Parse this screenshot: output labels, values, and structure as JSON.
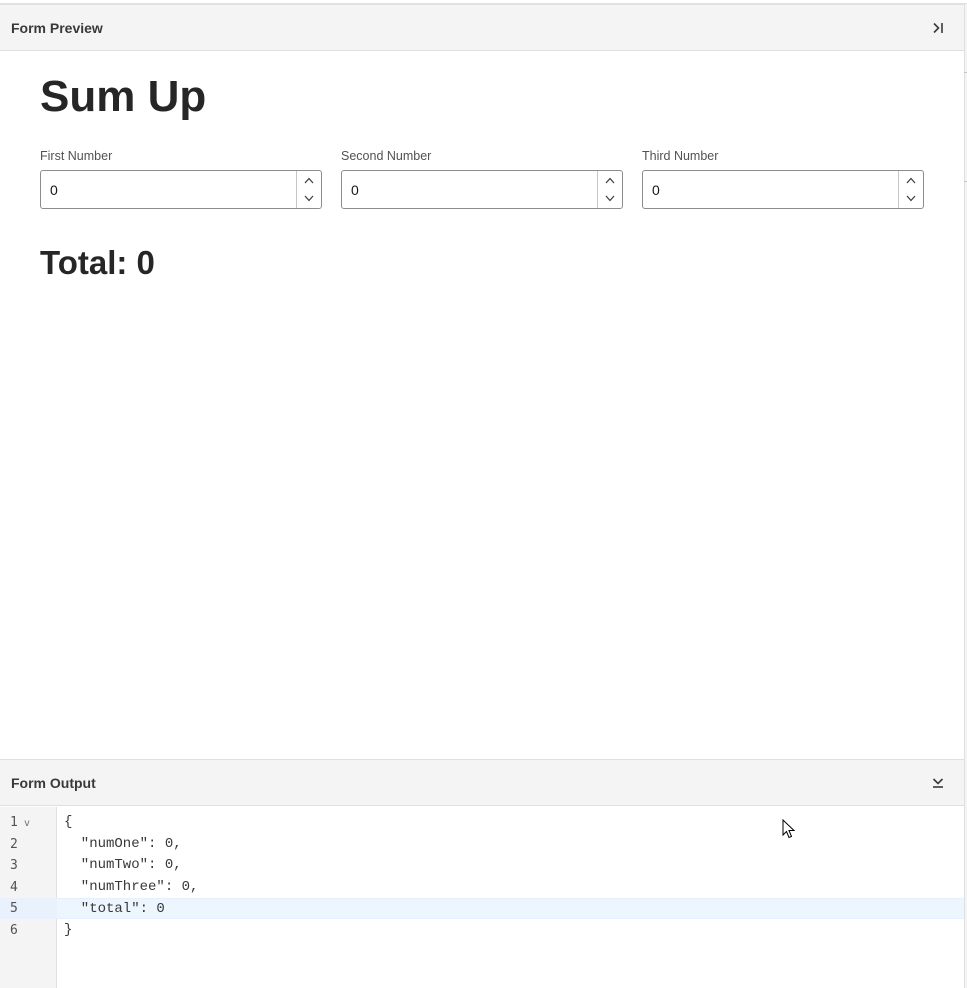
{
  "preview_panel": {
    "title": "Form Preview",
    "collapse_icon": "collapse-right-icon"
  },
  "form": {
    "title": "Sum Up",
    "fields": [
      {
        "label": "First Number",
        "value": "0"
      },
      {
        "label": "Second Number",
        "value": "0"
      },
      {
        "label": "Third Number",
        "value": "0"
      }
    ],
    "total_label": "Total: 0"
  },
  "output_panel": {
    "title": "Form Output",
    "collapse_icon": "collapse-down-icon"
  },
  "editor": {
    "line_numbers": [
      "1",
      "2",
      "3",
      "4",
      "5",
      "6"
    ],
    "fold_marker": "v",
    "lines": [
      "{",
      "  \"numOne\": 0,",
      "  \"numTwo\": 0,",
      "  \"numThree\": 0,",
      "  \"total\": 0",
      "}"
    ],
    "active_line": 5
  },
  "colors": {
    "header_bg": "#f4f4f4",
    "border": "#e0e0e0",
    "active_line": "#edf5ff",
    "text": "#161616"
  }
}
